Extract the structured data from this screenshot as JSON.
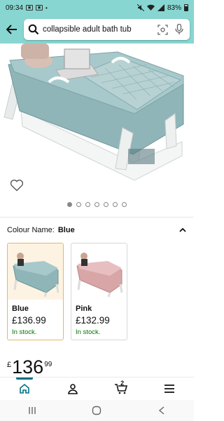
{
  "status_bar": {
    "time": "09:34",
    "battery": "83%"
  },
  "search": {
    "query": "collapsible adult bath tub"
  },
  "gallery": {
    "image_count": 7,
    "active_index": 0
  },
  "colour": {
    "label": "Colour Name:",
    "selected": "Blue",
    "options": [
      {
        "name": "Blue",
        "price": "£136.99",
        "stock": "In stock.",
        "tub_color": "#8fb5b8"
      },
      {
        "name": "Pink",
        "price": "£132.99",
        "stock": "In stock.",
        "tub_color": "#d9a6a8"
      }
    ]
  },
  "price": {
    "symbol": "£",
    "whole": "136",
    "fraction": "99"
  },
  "bottom_nav": {
    "cart_count": "2",
    "items": [
      "home-icon",
      "account-icon",
      "cart-icon",
      "menu-icon"
    ]
  },
  "colors": {
    "header_bg": "#87d6d1",
    "tub_blue": "#8fb5b8",
    "stock_green": "#007600",
    "active_nav": "#007185"
  }
}
